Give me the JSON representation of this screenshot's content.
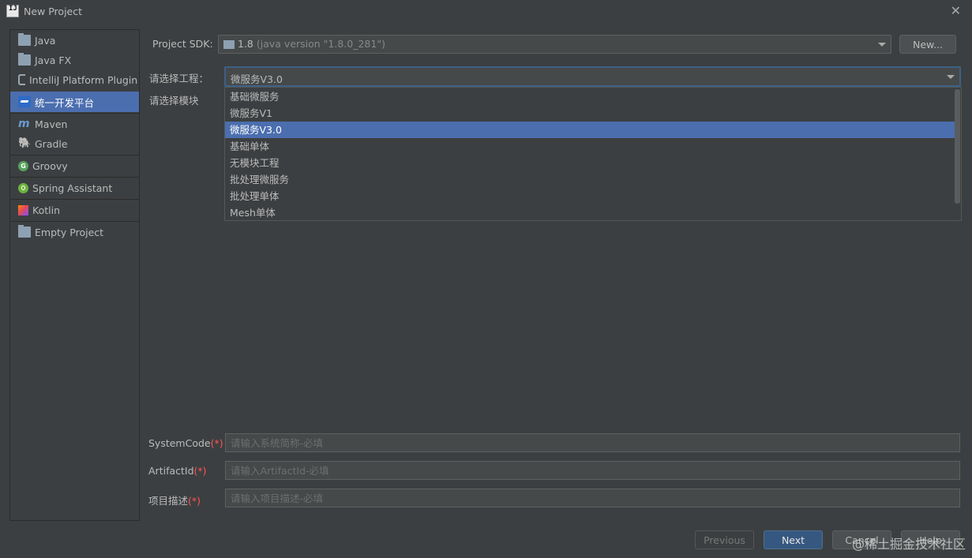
{
  "window": {
    "title": "New Project",
    "app_icon_text": "IJ",
    "close_symbol": "✕"
  },
  "sidebar": {
    "items": [
      {
        "label": "Java",
        "icon": "folder-icon"
      },
      {
        "label": "Java FX",
        "icon": "folder-icon"
      },
      {
        "label": "IntelliJ Platform Plugin",
        "icon": "plugin-icon"
      },
      {
        "label": "统一开发平台",
        "icon": "platform-icon",
        "selected": true
      },
      {
        "label": "Maven",
        "icon": "maven-icon",
        "glyph": "m"
      },
      {
        "label": "Gradle",
        "icon": "gradle-icon",
        "glyph": "🐘"
      },
      {
        "label": "Groovy",
        "icon": "groovy-icon",
        "glyph": "G"
      },
      {
        "label": "Spring Assistant",
        "icon": "spring-icon"
      },
      {
        "label": "Kotlin",
        "icon": "kotlin-icon"
      },
      {
        "label": "Empty Project",
        "icon": "folder-icon"
      }
    ]
  },
  "form": {
    "sdk_label": "Project SDK:",
    "sdk_value": "1.8",
    "sdk_hint": "(java version \"1.8.0_281\")",
    "new_button": "New...",
    "project_label": "请选择工程：",
    "project_value": "微服务V3.0",
    "module_label": "请选择模块",
    "project_options": [
      "基础微服务",
      "微服务V1",
      "微服务V3.0",
      "基础单体",
      "无模块工程",
      "批处理微服务",
      "批处理单体",
      "Mesh单体"
    ],
    "selected_option_index": 2,
    "system_code_label": "SystemCode",
    "system_code_placeholder": "请输入系统简称-必填",
    "artifact_label": "ArtifactId",
    "artifact_placeholder": "请输入ArtifactId-必填",
    "desc_label": "项目描述",
    "desc_placeholder": "请输入项目描述-必填",
    "required_mark": "(*)"
  },
  "footer": {
    "previous": "Previous",
    "next": "Next",
    "cancel": "Cancel",
    "help": "Help"
  },
  "watermark": "@稀土掘金技术社区",
  "colors": {
    "background": "#3c3f41",
    "selection": "#4b6eaf",
    "primary_button": "#365880",
    "required": "#ff5555"
  }
}
